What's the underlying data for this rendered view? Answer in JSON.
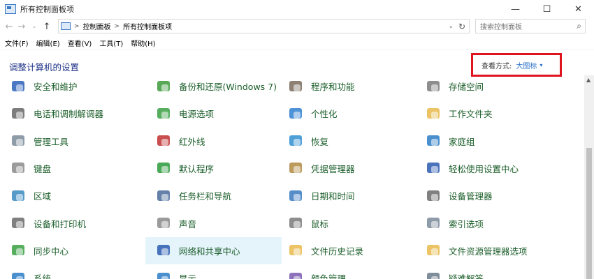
{
  "window": {
    "title": "所有控制面板项",
    "minimize": "—",
    "maximize": "☐",
    "close": "✕"
  },
  "address": {
    "back": "←",
    "forward": "→",
    "dropdown_history": "⌄",
    "up": "↑",
    "crumbs": [
      "控制面板",
      "所有控制面板项"
    ],
    "separator": ">",
    "drop": "⌄",
    "refresh": "↻"
  },
  "search": {
    "placeholder": "搜索控制面板",
    "icon": "⌕"
  },
  "menu": [
    "文件(F)",
    "编辑(E)",
    "查看(V)",
    "工具(T)",
    "帮助(H)"
  ],
  "header": {
    "title": "调整计算机的设置",
    "viewby_label": "查看方式:",
    "viewby_value": "大图标",
    "caret": "▾"
  },
  "items": [
    {
      "label": "安全和维护",
      "icon": "flag-icon",
      "color": "#2b5fb8"
    },
    {
      "label": "备份和还原(Windows 7)",
      "icon": "backup-icon",
      "color": "#3a9a3a"
    },
    {
      "label": "程序和功能",
      "icon": "programs-icon",
      "color": "#7a6a5a"
    },
    {
      "label": "存储空间",
      "icon": "storage-icon",
      "color": "#7a7a7a"
    },
    {
      "label": "电话和调制解调器",
      "icon": "phone-icon",
      "color": "#666666"
    },
    {
      "label": "电源选项",
      "icon": "power-icon",
      "color": "#3aa043"
    },
    {
      "label": "个性化",
      "icon": "personalize-icon",
      "color": "#2f7fd0"
    },
    {
      "label": "工作文件夹",
      "icon": "work-folder-icon",
      "color": "#e9b94a"
    },
    {
      "label": "管理工具",
      "icon": "admin-tools-icon",
      "color": "#7a8a9a"
    },
    {
      "label": "红外线",
      "icon": "infrared-icon",
      "color": "#c03030"
    },
    {
      "label": "恢复",
      "icon": "recovery-icon",
      "color": "#2f8fd0"
    },
    {
      "label": "家庭组",
      "icon": "homegroup-icon",
      "color": "#2a7cc7"
    },
    {
      "label": "键盘",
      "icon": "keyboard-icon",
      "color": "#8a8a8a"
    },
    {
      "label": "默认程序",
      "icon": "default-programs-icon",
      "color": "#2a9a3a"
    },
    {
      "label": "凭据管理器",
      "icon": "credential-icon",
      "color": "#b08a40"
    },
    {
      "label": "轻松使用设置中心",
      "icon": "ease-of-access-icon",
      "color": "#2a5ab0"
    },
    {
      "label": "区域",
      "icon": "region-icon",
      "color": "#3a8ac0"
    },
    {
      "label": "任务栏和导航",
      "icon": "taskbar-icon",
      "color": "#4a6a9a"
    },
    {
      "label": "日期和时间",
      "icon": "datetime-icon",
      "color": "#3a7ac0"
    },
    {
      "label": "设备管理器",
      "icon": "device-manager-icon",
      "color": "#6a6a6a"
    },
    {
      "label": "设备和打印机",
      "icon": "printer-icon",
      "color": "#6a6a6a"
    },
    {
      "label": "声音",
      "icon": "sound-icon",
      "color": "#8a8a8a"
    },
    {
      "label": "鼠标",
      "icon": "mouse-icon",
      "color": "#7a7a7a"
    },
    {
      "label": "索引选项",
      "icon": "indexing-icon",
      "color": "#7a8a9a"
    },
    {
      "label": "同步中心",
      "icon": "sync-icon",
      "color": "#3aa043"
    },
    {
      "label": "网络和共享中心",
      "icon": "network-icon",
      "color": "#2a5ab0",
      "selected": true
    },
    {
      "label": "文件历史记录",
      "icon": "file-history-icon",
      "color": "#e9b94a"
    },
    {
      "label": "文件资源管理器选项",
      "icon": "folder-options-icon",
      "color": "#e9b94a"
    },
    {
      "label": "系统",
      "icon": "system-icon",
      "color": "#2a7cc7"
    },
    {
      "label": "显示",
      "icon": "display-icon",
      "color": "#2a7cc7"
    },
    {
      "label": "颜色管理",
      "icon": "color-management-icon",
      "color": "#7a5ab0"
    },
    {
      "label": "疑难解答",
      "icon": "troubleshoot-icon",
      "color": "#6a7a8a"
    }
  ],
  "scrollbar": {
    "up_arrow": "▲",
    "position": 0.35
  }
}
